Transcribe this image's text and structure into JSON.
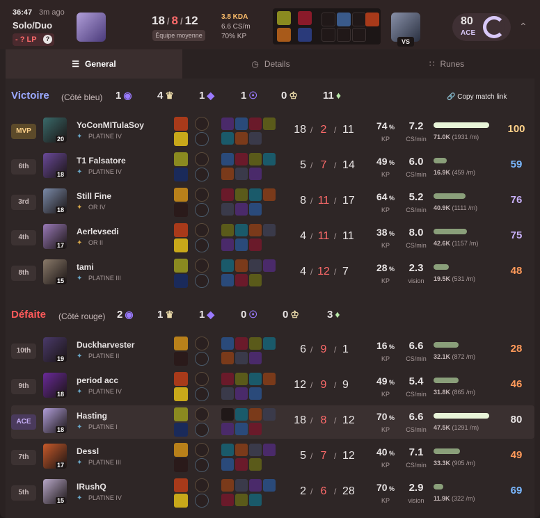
{
  "header": {
    "time": "36:47",
    "ago": "3m ago",
    "queue": "Solo/Duo",
    "lp": "- ? LP",
    "lp_help": "?",
    "kills": "18",
    "deaths": "8",
    "assists": "12",
    "team_badge": "Équipe moyenne",
    "kda": "3.8 KDA",
    "cs_per_min": "6.6 CS/m",
    "kp": "70% KP",
    "vs": "VS",
    "score": "80",
    "score_label": "ACE"
  },
  "tabs": [
    {
      "label": "General",
      "icon": "list-icon"
    },
    {
      "label": "Details",
      "icon": "clock-icon"
    },
    {
      "label": "Runes",
      "icon": "grid-icon"
    }
  ],
  "teams": [
    {
      "title": "Victoire",
      "side": "(Côté bleu)",
      "title_color": "#9aa8ff",
      "objectives": [
        "1",
        "4",
        "1",
        "1",
        "0",
        "11"
      ],
      "copy_link": "Copy match link",
      "players": [
        {
          "rank": "MVP",
          "name": "YoConMITulaSoy",
          "tier": "PLATINE IV",
          "level": "20",
          "k": "18",
          "d": "2",
          "a": "11",
          "kp": "74",
          "cs": "7.2",
          "cs_label": "CS/min",
          "dmg": "71.0K",
          "dmg_pm": "(1931 /m)",
          "score": "100",
          "score_color": "#ffd28a",
          "dmg_frac": 1.0,
          "champ_color": "#3a6a6a"
        },
        {
          "rank": "6th",
          "name": "T1 Falsatore",
          "tier": "PLATINE IV",
          "level": "18",
          "k": "5",
          "d": "7",
          "a": "14",
          "kp": "49",
          "cs": "6.0",
          "cs_label": "CS/min",
          "dmg": "16.9K",
          "dmg_pm": "(459 /m)",
          "score": "59",
          "score_color": "#7ab8ff",
          "dmg_frac": 0.24,
          "champ_color": "#6a4a9a"
        },
        {
          "rank": "3rd",
          "name": "Still Fine",
          "tier": "OR IV",
          "level": "18",
          "k": "8",
          "d": "11",
          "a": "17",
          "kp": "64",
          "cs": "5.2",
          "cs_label": "CS/min",
          "dmg": "40.9K",
          "dmg_pm": "(1111 /m)",
          "score": "76",
          "score_color": "#c8b0f8",
          "dmg_frac": 0.58,
          "champ_color": "#7a8aa8"
        },
        {
          "rank": "4th",
          "name": "Aerlevsedi",
          "tier": "OR II",
          "level": "17",
          "k": "4",
          "d": "11",
          "a": "11",
          "kp": "38",
          "cs": "8.0",
          "cs_label": "CS/min",
          "dmg": "42.6K",
          "dmg_pm": "(1157 /m)",
          "score": "75",
          "score_color": "#c8b0f8",
          "dmg_frac": 0.6,
          "champ_color": "#9a7ab8"
        },
        {
          "rank": "8th",
          "name": "tami",
          "tier": "PLATINE III",
          "level": "15",
          "k": "4",
          "d": "12",
          "a": "7",
          "kp": "28",
          "cs": "2.3",
          "cs_label": "vision",
          "dmg": "19.5K",
          "dmg_pm": "(531 /m)",
          "score": "48",
          "score_color": "#ff9a5a",
          "dmg_frac": 0.28,
          "champ_color": "#8a7a6a"
        }
      ]
    },
    {
      "title": "Défaite",
      "side": "(Côté rouge)",
      "title_color": "#ff5a5a",
      "objectives": [
        "2",
        "1",
        "1",
        "0",
        "0",
        "3"
      ],
      "players": [
        {
          "rank": "10th",
          "name": "Duckharvester",
          "tier": "PLATINE II",
          "level": "19",
          "k": "6",
          "d": "9",
          "a": "1",
          "kp": "16",
          "cs": "6.6",
          "cs_label": "CS/min",
          "dmg": "32.1K",
          "dmg_pm": "(872 /m)",
          "score": "28",
          "score_color": "#ff9a5a",
          "dmg_frac": 0.45,
          "champ_color": "#4a3a6a"
        },
        {
          "rank": "9th",
          "name": "period acc",
          "tier": "PLATINE IV",
          "level": "18",
          "k": "12",
          "d": "9",
          "a": "9",
          "kp": "49",
          "cs": "5.4",
          "cs_label": "CS/min",
          "dmg": "31.8K",
          "dmg_pm": "(865 /m)",
          "score": "46",
          "score_color": "#ff9a5a",
          "dmg_frac": 0.45,
          "champ_color": "#6a2a9a"
        },
        {
          "rank": "ACE",
          "name": "Hasting",
          "tier": "PLATINE I",
          "level": "18",
          "k": "18",
          "d": "8",
          "a": "12",
          "kp": "70",
          "cs": "6.6",
          "cs_label": "CS/min",
          "dmg": "47.5K",
          "dmg_pm": "(1291 /m)",
          "score": "80",
          "score_color": "#e8e4e4",
          "dmg_frac": 1.0,
          "champ_color": "#b09ed8",
          "highlight": true
        },
        {
          "rank": "7th",
          "name": "Dessl",
          "tier": "PLATINE III",
          "level": "17",
          "k": "5",
          "d": "7",
          "a": "12",
          "kp": "40",
          "cs": "7.1",
          "cs_label": "CS/min",
          "dmg": "33.3K",
          "dmg_pm": "(905 /m)",
          "score": "49",
          "score_color": "#ff9a5a",
          "dmg_frac": 0.47,
          "champ_color": "#c85a2a"
        },
        {
          "rank": "5th",
          "name": "IRushQ",
          "tier": "PLATINE IV",
          "level": "15",
          "k": "2",
          "d": "6",
          "a": "28",
          "kp": "70",
          "cs": "2.9",
          "cs_label": "vision",
          "dmg": "11.9K",
          "dmg_pm": "(322 /m)",
          "score": "69",
          "score_color": "#7ab8ff",
          "dmg_frac": 0.17,
          "champ_color": "#b8a8c8"
        }
      ]
    }
  ],
  "kp_label": "KP"
}
